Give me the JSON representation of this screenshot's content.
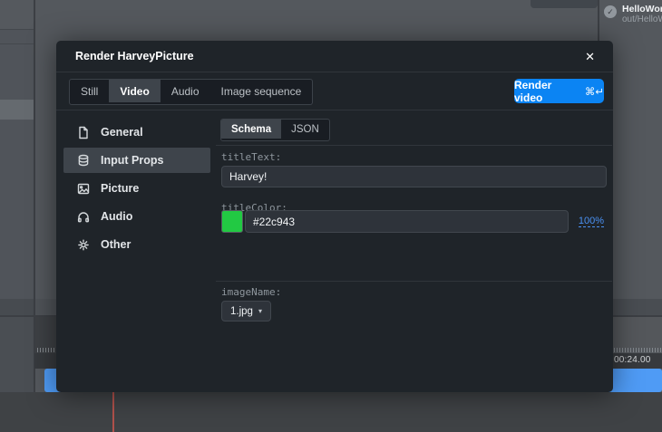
{
  "icons": {
    "check": "✓",
    "close": "✕",
    "caret_down": "▾"
  },
  "colors": {
    "accent_blue": "#0b84f3",
    "title_color_green": "#22c943",
    "timeline_bar_blue": "#4f9bf5",
    "playhead_red": "#b0514b",
    "link_blue": "#4a91f2"
  },
  "background": {
    "render_item": {
      "name": "HelloWorld",
      "path": "out/HelloWorl"
    },
    "timeline": {
      "timecode": "00:24.00"
    }
  },
  "modal": {
    "title": "Render HarveyPicture",
    "tabs": [
      {
        "label": "Still"
      },
      {
        "label": "Video"
      },
      {
        "label": "Audio"
      },
      {
        "label": "Image sequence"
      }
    ],
    "render_button": {
      "label": "Render video",
      "shortcut": "⌘↵"
    },
    "sidebar": [
      {
        "label": "General"
      },
      {
        "label": "Input Props"
      },
      {
        "label": "Picture"
      },
      {
        "label": "Audio"
      },
      {
        "label": "Other"
      }
    ],
    "view_tabs": [
      {
        "label": "Schema"
      },
      {
        "label": "JSON"
      }
    ],
    "fields": {
      "titleText": {
        "label": "titleText:",
        "value": "Harvey!"
      },
      "titleColor": {
        "label": "titleColor:",
        "value": "#22c943",
        "swatch": "#22c943",
        "opacity": "100%"
      },
      "imageName": {
        "label": "imageName:",
        "value": "1.jpg"
      }
    }
  }
}
